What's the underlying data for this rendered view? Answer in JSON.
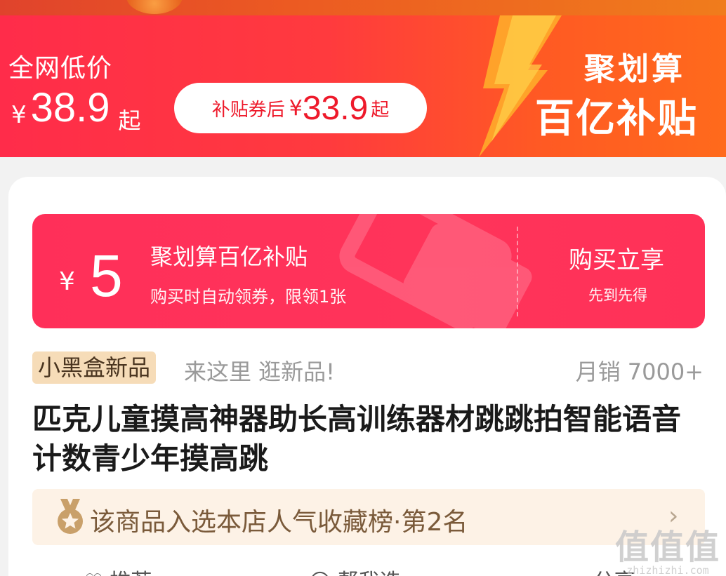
{
  "price_banner": {
    "label": "全网低价",
    "currency": "¥",
    "price": "38.9",
    "price_suffix": "起",
    "coupon_label": "补贴券后",
    "coupon_currency": "¥",
    "coupon_price": "33.9",
    "coupon_suffix": "起",
    "brand_line1": "聚划算",
    "brand_line2": "百亿补贴"
  },
  "subsidy_coupon": {
    "currency": "¥",
    "amount": "5",
    "title": "聚划算百亿补贴",
    "description": "购买时自动领券，限领1张",
    "cta": "购买立享",
    "cta_sub": "先到先得"
  },
  "tag_row": {
    "tag": "小黑盒新品",
    "slogan": "来这里 逛新品!",
    "monthly_sales": "月销 7000+"
  },
  "product": {
    "title": "匹克儿童摸高神器助长高训练器材跳跳拍智能语音计数青少年摸高跳"
  },
  "ranking": {
    "text": "该商品入选本店人气收藏榜·第2名",
    "chevron": "›"
  },
  "bottom_row": {
    "item1": "推荐",
    "item2": "帮我选",
    "item3": "分享"
  },
  "watermark": {
    "big": "值值值",
    "small": "zhizhizhi.com"
  },
  "colors": {
    "banner_red": "#ff2c4a",
    "banner_orange": "#ff6a1c",
    "subsidy_pink": "#ff2f59",
    "coupon_text_red": "#ee1a2b",
    "tag_bg": "#f6dcb8",
    "rank_bg": "#fdf2e6"
  }
}
